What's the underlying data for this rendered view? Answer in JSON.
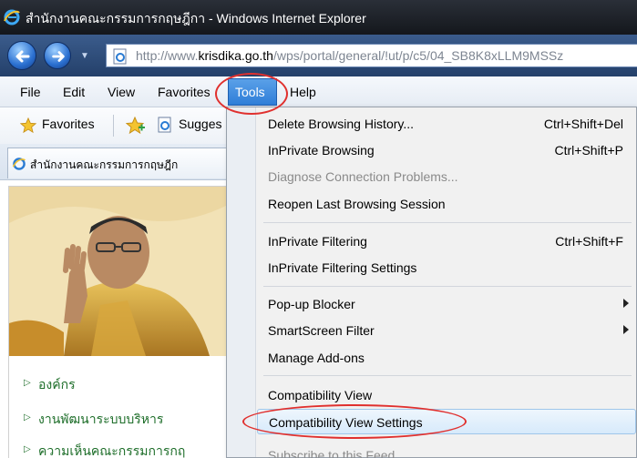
{
  "window": {
    "title": "สำนักงานคณะกรรมการกฤษฎีกา - Windows Internet Explorer"
  },
  "address_bar": {
    "url_prefix": "http://www.",
    "url_domain": "krisdika.go.th",
    "url_rest": "/wps/portal/general/!ut/p/c5/04_SB8K8xLLM9MSSz"
  },
  "menu_bar": {
    "items": [
      "File",
      "Edit",
      "View",
      "Favorites",
      "Tools",
      "Help"
    ]
  },
  "favorites_bar": {
    "favorites_label": "Favorites",
    "suggested_label": "Sugges"
  },
  "tab": {
    "title": "สำนักงานคณะกรรมการกฤษฎีก"
  },
  "left_nav": {
    "links": [
      "องค์กร",
      "งานพัฒนาระบบบริหาร",
      "ความเห็นคณะกรรมการกฤ"
    ]
  },
  "tools_menu": {
    "items": [
      {
        "label": "Delete Browsing History...",
        "shortcut": "Ctrl+Shift+Del"
      },
      {
        "label": "InPrivate Browsing",
        "shortcut": "Ctrl+Shift+P"
      },
      {
        "label": "Diagnose Connection Problems...",
        "shortcut": ""
      },
      {
        "label": "Reopen Last Browsing Session",
        "shortcut": ""
      },
      {
        "label": "InPrivate Filtering",
        "shortcut": "Ctrl+Shift+F"
      },
      {
        "label": "InPrivate Filtering Settings",
        "shortcut": ""
      },
      {
        "label": "Pop-up Blocker",
        "shortcut": ""
      },
      {
        "label": "SmartScreen Filter",
        "shortcut": ""
      },
      {
        "label": "Manage Add-ons",
        "shortcut": ""
      },
      {
        "label": "Compatibility View",
        "shortcut": ""
      },
      {
        "label": "Compatibility View Settings",
        "shortcut": ""
      },
      {
        "label": "Subscribe to this Feed...",
        "shortcut": ""
      }
    ]
  },
  "colors": {
    "menu_highlight": "#2f7ed8",
    "annotation": "#e0302e",
    "nav_link": "#1e6e2a"
  }
}
